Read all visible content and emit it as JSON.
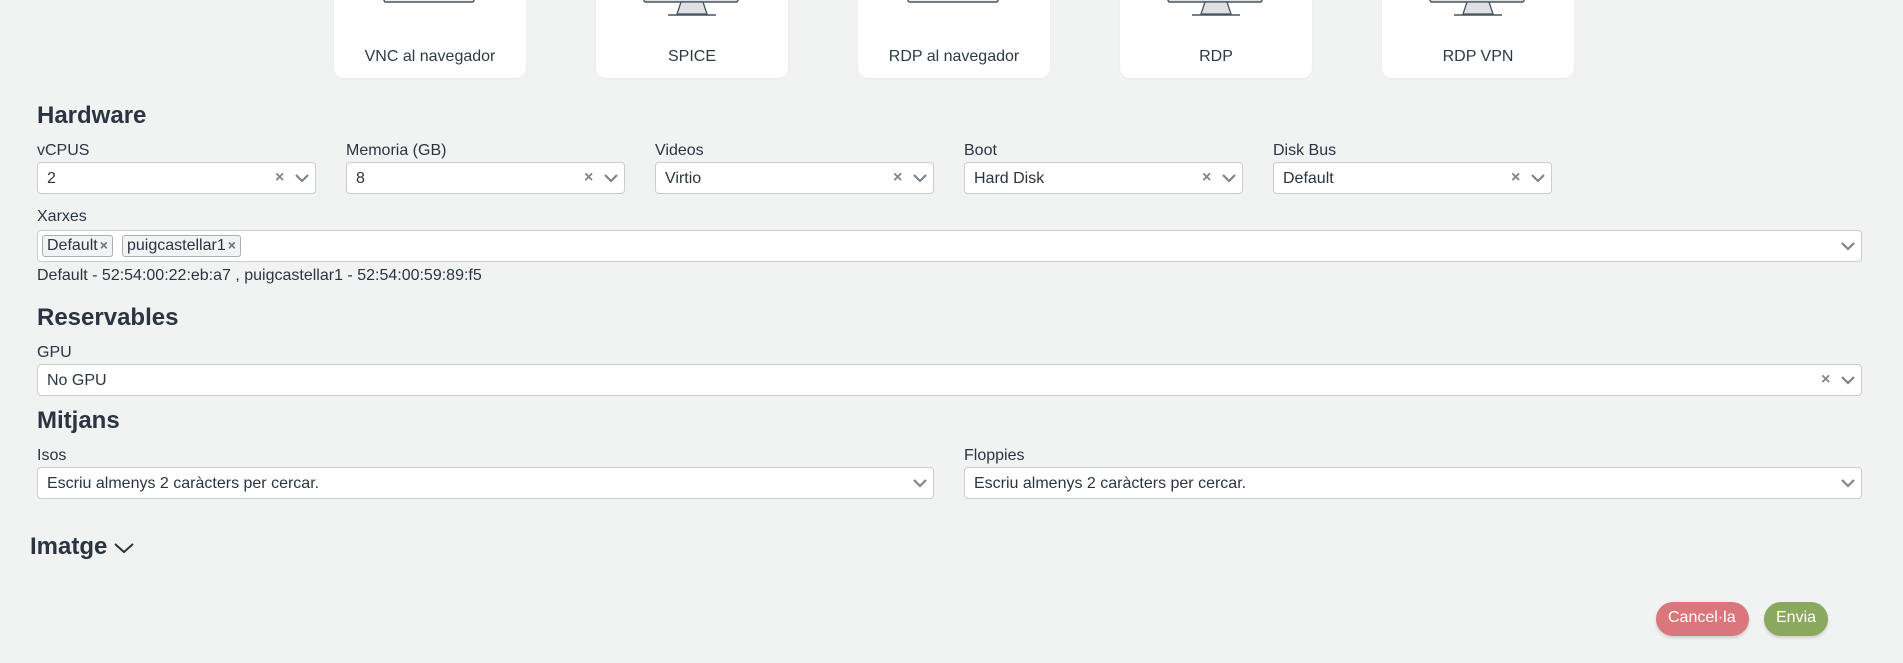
{
  "viewers": [
    {
      "label": "VNC al navegador",
      "icon": "monitor-icon"
    },
    {
      "label": "SPICE",
      "icon": "desktop-icon"
    },
    {
      "label": "RDP al navegador",
      "icon": "monitor-icon"
    },
    {
      "label": "RDP",
      "icon": "desktop-icon"
    },
    {
      "label": "RDP VPN",
      "icon": "desktop-icon"
    }
  ],
  "hardware": {
    "title": "Hardware",
    "vcpus": {
      "label": "vCPUS",
      "value": "2"
    },
    "memory": {
      "label": "Memoria (GB)",
      "value": "8"
    },
    "videos": {
      "label": "Videos",
      "value": "Virtio"
    },
    "boot": {
      "label": "Boot",
      "value": "Hard Disk"
    },
    "disk_bus": {
      "label": "Disk Bus",
      "value": "Default"
    },
    "networks": {
      "label": "Xarxes",
      "selected": [
        "Default",
        "puigcastellar1"
      ],
      "macs": "Default - 52:54:00:22:eb:a7 , puigcastellar1 - 52:54:00:59:89:f5"
    }
  },
  "reservables": {
    "title": "Reservables",
    "gpu": {
      "label": "GPU",
      "value": "No GPU"
    }
  },
  "media": {
    "title": "Mitjans",
    "isos": {
      "label": "Isos",
      "placeholder": "Escriu almenys 2 caràcters per cercar."
    },
    "floppies": {
      "label": "Floppies",
      "placeholder": "Escriu almenys 2 caràcters per cercar."
    }
  },
  "image": {
    "title": "Imatge"
  },
  "actions": {
    "cancel": "Cancel·la",
    "send": "Envia"
  },
  "colors": {
    "background": "#f1f3f2",
    "cancel": "#d9777c",
    "send": "#8aa95f"
  }
}
